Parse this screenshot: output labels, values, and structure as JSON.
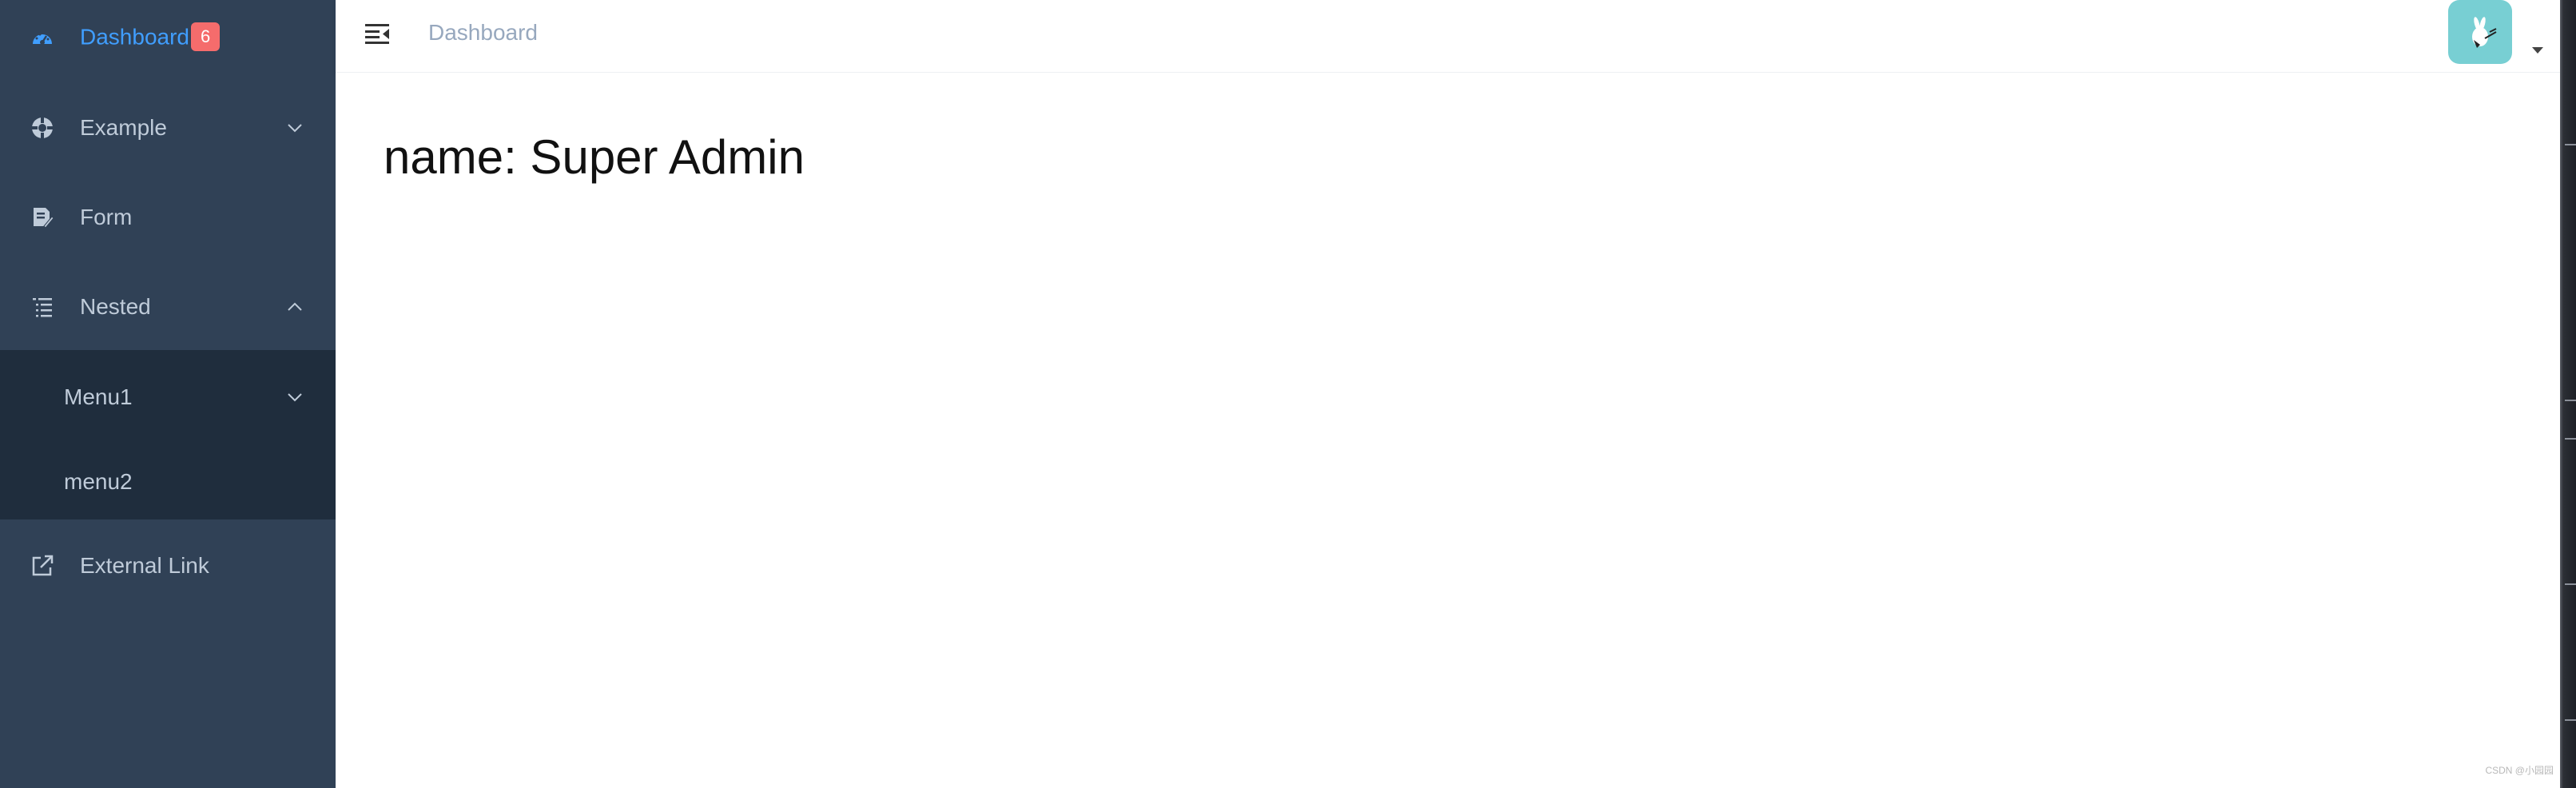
{
  "sidebar": {
    "items": [
      {
        "label": "Dashboard",
        "icon": "dashboard-icon",
        "badge": "6"
      },
      {
        "label": "Example",
        "icon": "example-icon"
      },
      {
        "label": "Form",
        "icon": "form-icon"
      },
      {
        "label": "Nested",
        "icon": "nested-icon"
      },
      {
        "label": "External Link",
        "icon": "external-link-icon"
      }
    ],
    "submenu": [
      {
        "label": "Menu1"
      },
      {
        "label": "menu2"
      }
    ]
  },
  "navbar": {
    "breadcrumb": "Dashboard",
    "avatar_icon": "avatar-image"
  },
  "main": {
    "dashboard_text": "name: Super Admin"
  },
  "footer": {
    "watermark": "CSDN @小园园"
  },
  "colors": {
    "sidebar_bg": "#304156",
    "submenu_bg": "#1f2d3d",
    "active": "#409eff",
    "badge": "#f56c6c",
    "avatar_bg": "#78cfd3"
  }
}
